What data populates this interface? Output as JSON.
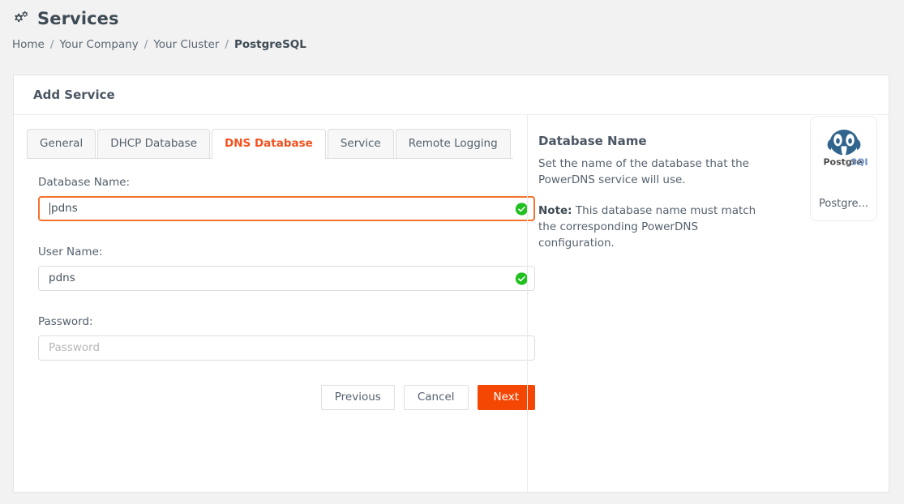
{
  "header": {
    "icon": "gears-icon",
    "title": "Services"
  },
  "breadcrumb": {
    "separator": "/",
    "items": [
      {
        "label": "Home",
        "active": false
      },
      {
        "label": "Your Company",
        "active": false
      },
      {
        "label": "Your Cluster",
        "active": false
      },
      {
        "label": "PostgreSQL",
        "active": true
      }
    ]
  },
  "card": {
    "title": "Add Service"
  },
  "tabs": [
    {
      "label": "General",
      "active": false
    },
    {
      "label": "DHCP Database",
      "active": false
    },
    {
      "label": "DNS Database",
      "active": true
    },
    {
      "label": "Service",
      "active": false
    },
    {
      "label": "Remote Logging",
      "active": false
    }
  ],
  "form": {
    "fields": [
      {
        "label": "Database Name:",
        "value": "pdns",
        "placeholder": "",
        "focused": true,
        "valid": true,
        "caret": true
      },
      {
        "label": "User Name:",
        "value": "pdns",
        "placeholder": "",
        "focused": false,
        "valid": true,
        "caret": false
      },
      {
        "label": "Password:",
        "value": "",
        "placeholder": "Password",
        "focused": false,
        "valid": false,
        "caret": false
      }
    ],
    "buttons": {
      "previous": "Previous",
      "cancel": "Cancel",
      "next": "Next"
    }
  },
  "help": {
    "title": "Database Name",
    "paragraph": "Set the name of the database that the PowerDNS service will use.",
    "note_label": "Note:",
    "note_text": " This database name must match the corresponding PowerDNS configuration."
  },
  "logo_card": {
    "logo_name": "postgresql-logo",
    "wordmark_dark": "Postgre",
    "wordmark_blue": "SQL",
    "caption": "Postgre..."
  },
  "colors": {
    "accent_orange": "#f54704",
    "tab_active_text": "#f4511e",
    "focus_border": "#f4732b",
    "valid_green": "#1fc01f",
    "page_bg": "#f2f2f2",
    "postgres_blue": "#31648c"
  }
}
